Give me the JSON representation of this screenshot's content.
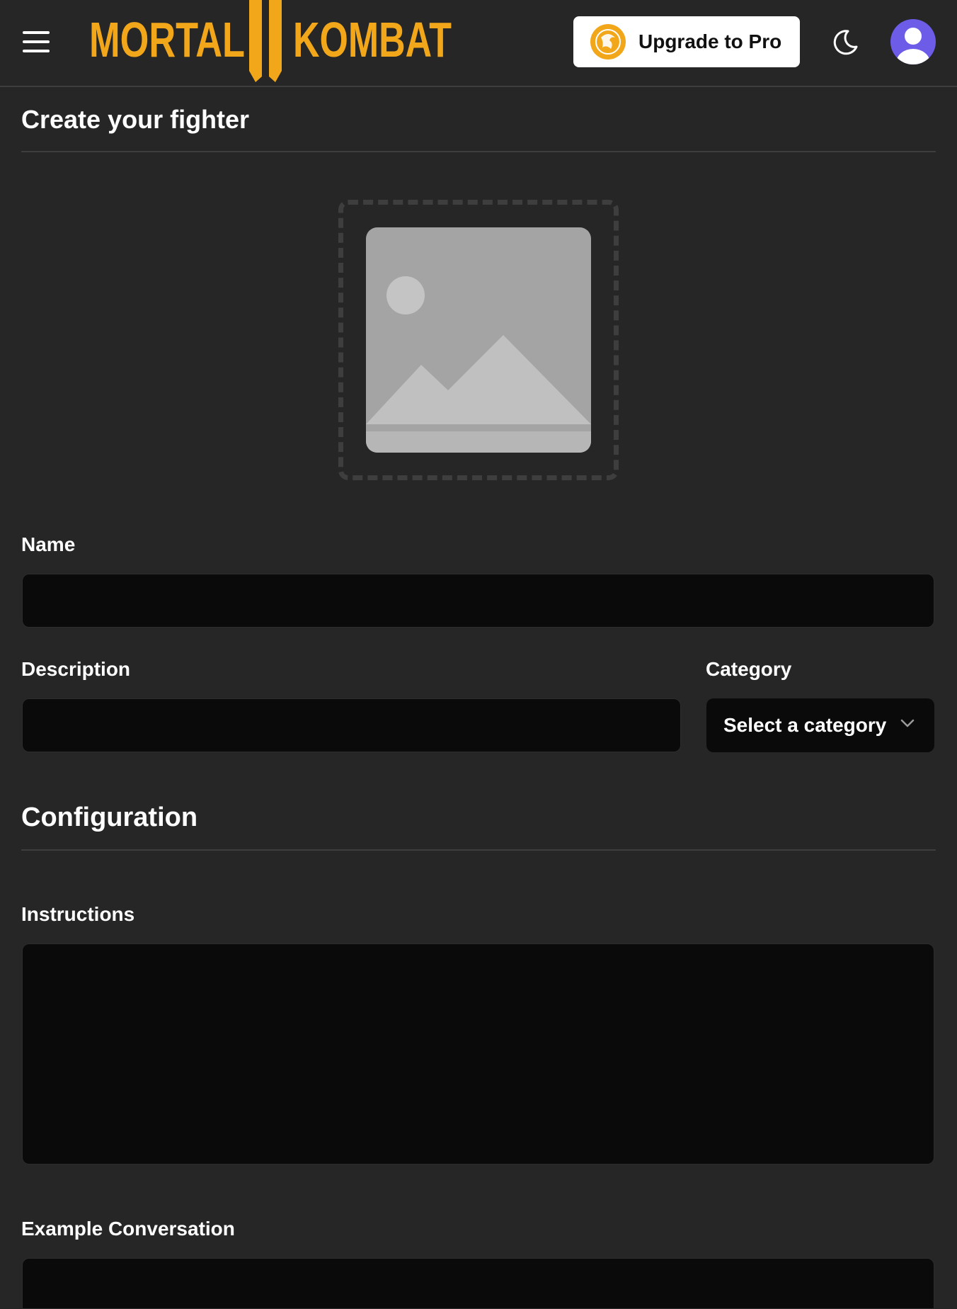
{
  "header": {
    "brand": "MORTAL KOMBAT",
    "upgrade_label": "Upgrade to Pro"
  },
  "form": {
    "title": "Create your fighter",
    "name": {
      "label": "Name",
      "value": ""
    },
    "description": {
      "label": "Description",
      "value": ""
    },
    "category": {
      "label": "Category",
      "selected": "Select a category"
    }
  },
  "configuration": {
    "title": "Configuration",
    "instructions": {
      "label": "Instructions",
      "value": ""
    },
    "example_conversation": {
      "label": "Example Conversation",
      "value": ""
    }
  },
  "colors": {
    "background": "#262626",
    "field_background": "#0a0a0a",
    "brand_gold": "#f2a71b",
    "avatar_purple": "#6c5ce7"
  }
}
